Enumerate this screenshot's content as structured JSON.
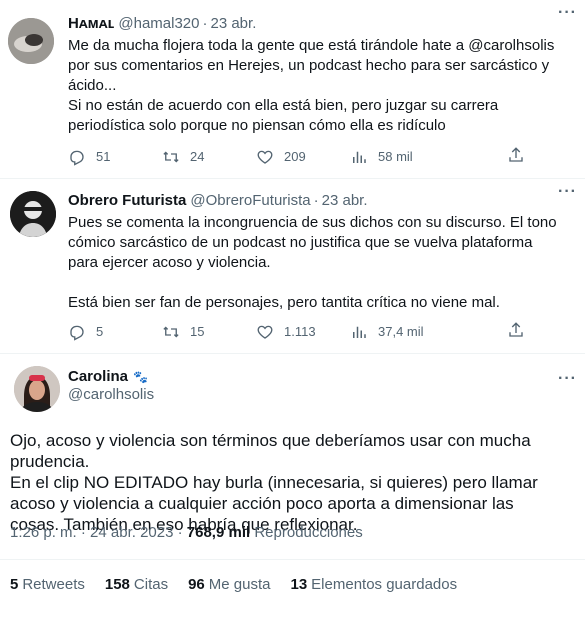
{
  "tweets": [
    {
      "name": "Hᴀᴍᴀʟ",
      "handle": "@hamal320",
      "date": "23 abr.",
      "lines": [
        "Me da mucha flojera toda la gente que está tirándole hate a @carolhsolis",
        "por sus comentarios en Herejes, un podcast hecho para ser sarcástico y",
        "ácido...",
        "Si no están de acuerdo con ella está bien, pero juzgar su carrera",
        "periodística solo porque no piensan cómo ella es ridículo"
      ],
      "replies": "51",
      "retweets": "24",
      "likes": "209",
      "views": "58 mil"
    },
    {
      "name": "Obrero Futurista",
      "handle": "@ObreroFuturista",
      "date": "23 abr.",
      "lines": [
        "Pues se comenta la incongruencia de sus dichos con su discurso. El tono",
        "cómico sarcástico de un podcast no justifica que se vuelva plataforma",
        "para ejercer acoso y violencia.",
        "Está bien ser fan de personajes, pero tantita crítica no viene mal."
      ],
      "replies": "5",
      "retweets": "15",
      "likes": "1.113",
      "views": "37,4 mil"
    }
  ],
  "main": {
    "name": "Carolina",
    "handle": "@carolhsolis",
    "lines": [
      "Ojo, acoso y violencia son términos que deberíamos usar con mucha",
      "prudencia.",
      "En el clip NO EDITADO hay burla (innecesaria, si quieres) pero llamar",
      "acoso y violencia a cualquier acción poco aporta a dimensionar las",
      "cosas. También en eso habría que reflexionar."
    ],
    "time": "1:26 p. m. · 24 abr. 2023 ·",
    "views": "768,9 mil",
    "views_label": "Reproducciones",
    "stats": [
      {
        "value": "5",
        "label": "Retweets"
      },
      {
        "value": "158",
        "label": "Citas"
      },
      {
        "value": "96",
        "label": "Me gusta"
      },
      {
        "value": "13",
        "label": "Elementos guardados"
      }
    ]
  },
  "icons": {
    "reply": "reply-icon",
    "retweet": "retweet-icon",
    "like": "heart-icon",
    "views": "analytics-icon",
    "share": "share-icon",
    "more": "more-icon"
  },
  "more_glyph": "···",
  "paw_glyph": "🐾"
}
